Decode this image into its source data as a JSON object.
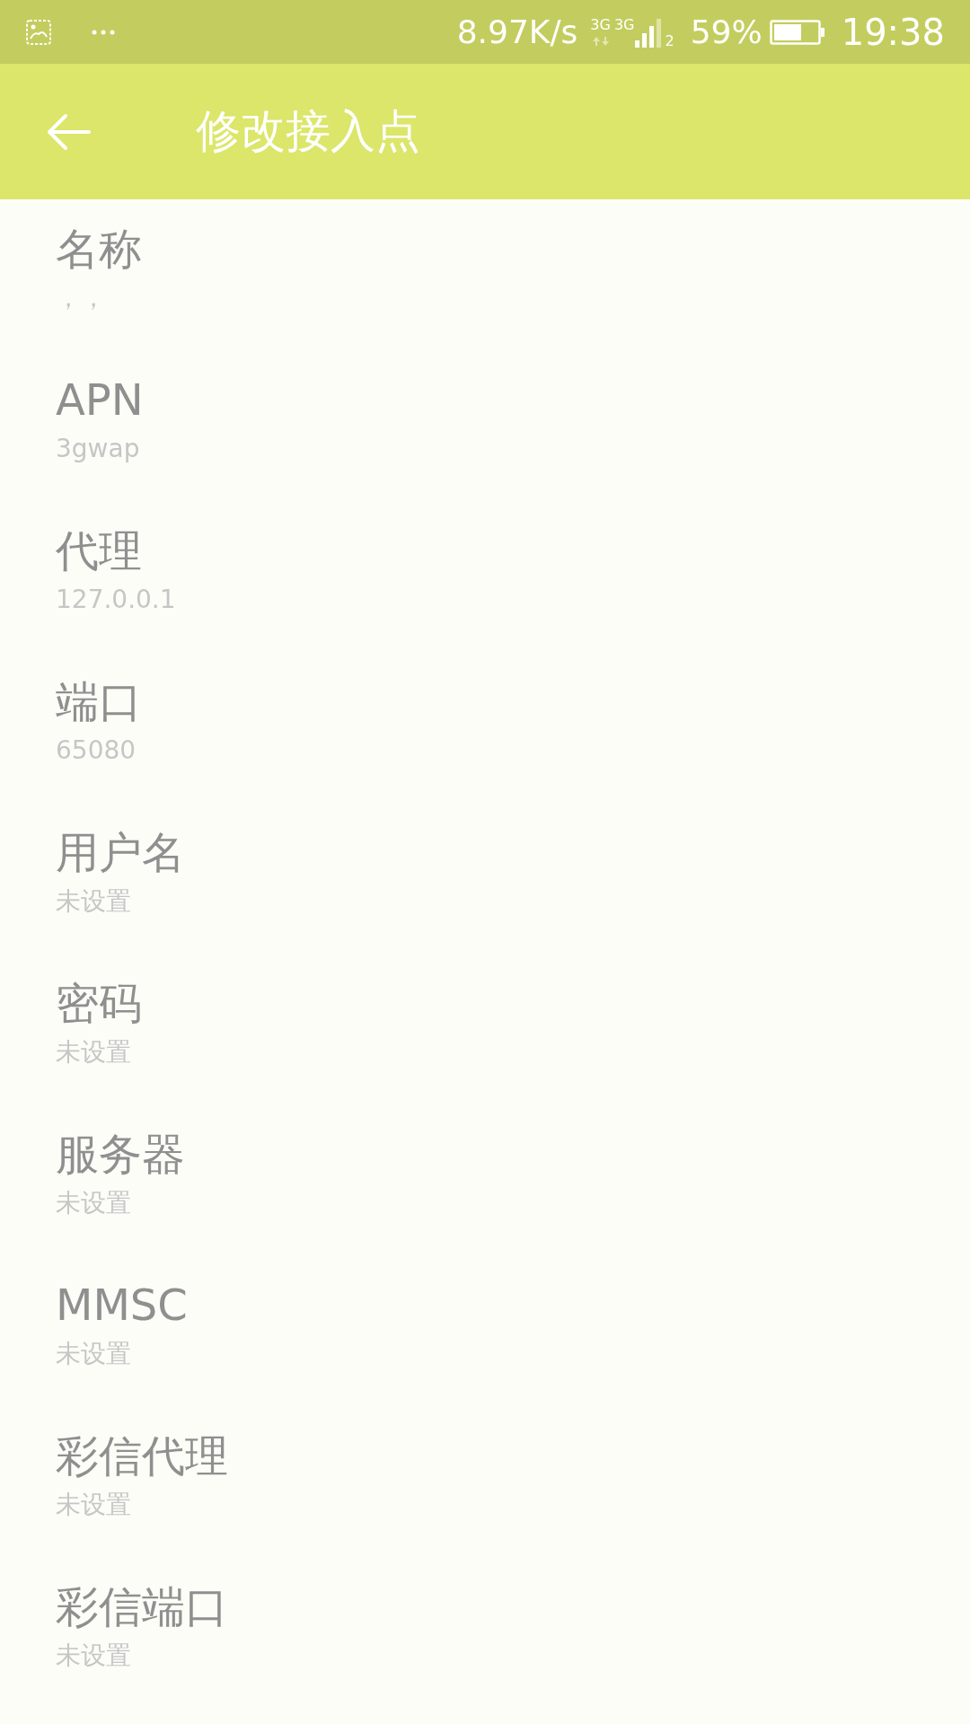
{
  "status_bar": {
    "speed": "8.97K/s",
    "network_1": "3G",
    "network_2": "3G",
    "sim": "2",
    "battery": "59%",
    "time": "19:38"
  },
  "app_bar": {
    "title": "修改接入点"
  },
  "settings": [
    {
      "label": "名称",
      "value": "，，"
    },
    {
      "label": "APN",
      "value": "3gwap"
    },
    {
      "label": "代理",
      "value": "127.0.0.1"
    },
    {
      "label": "端口",
      "value": "65080"
    },
    {
      "label": "用户名",
      "value": "未设置"
    },
    {
      "label": "密码",
      "value": "未设置"
    },
    {
      "label": "服务器",
      "value": "未设置"
    },
    {
      "label": "MMSC",
      "value": "未设置"
    },
    {
      "label": "彩信代理",
      "value": "未设置"
    },
    {
      "label": "彩信端口",
      "value": "未设置"
    }
  ]
}
